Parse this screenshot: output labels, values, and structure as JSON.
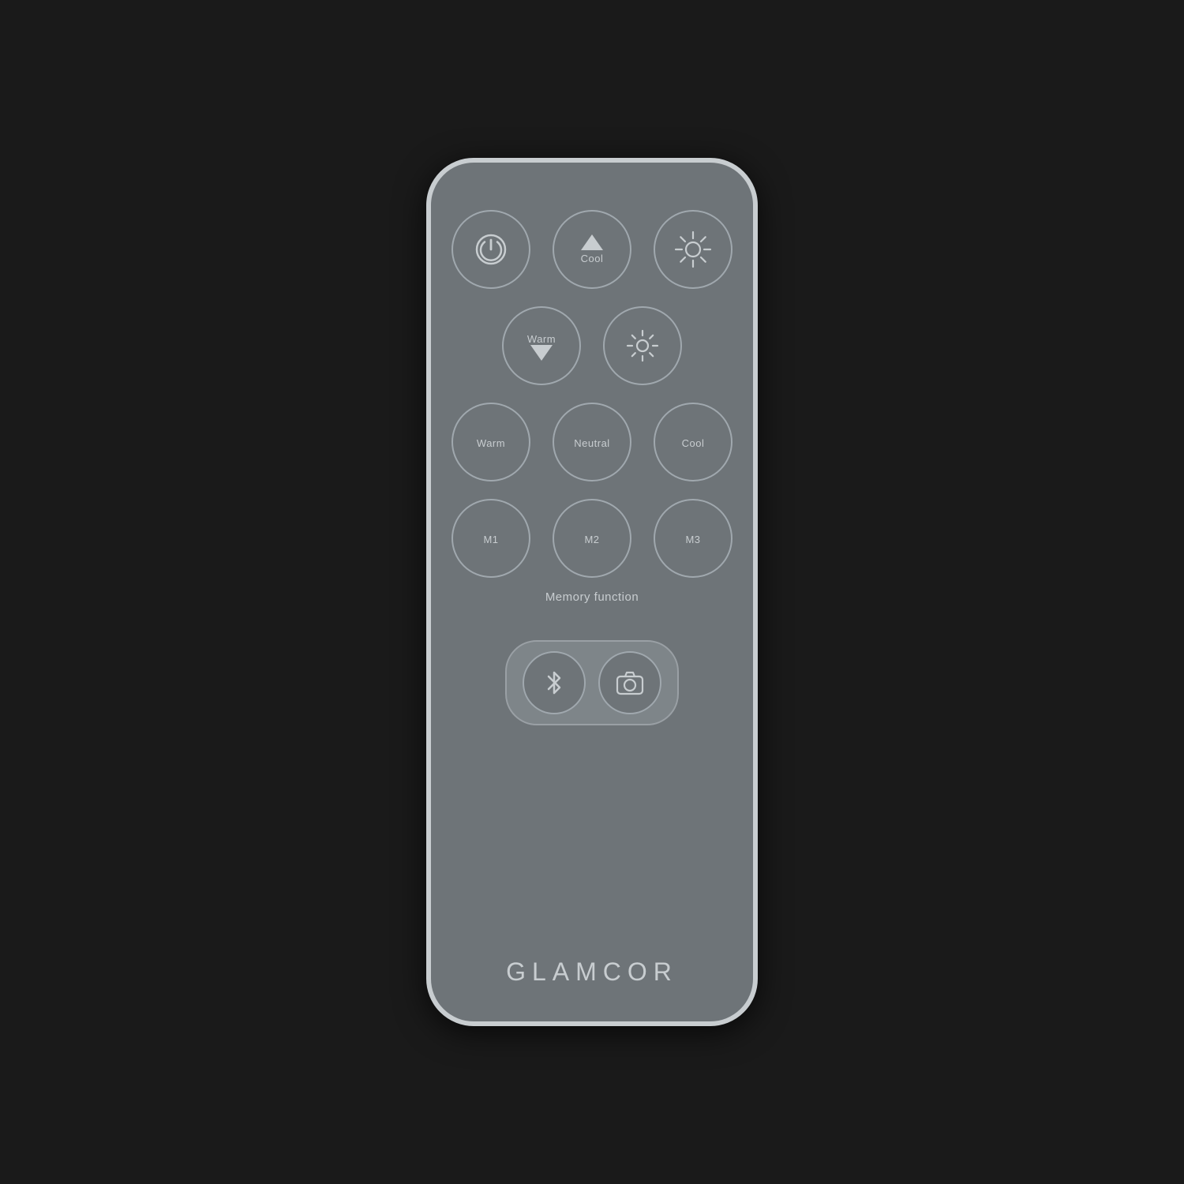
{
  "remote": {
    "brand": "GLAMCOR",
    "row1": {
      "btn1": {
        "label": "",
        "type": "power"
      },
      "btn2": {
        "label": "Cool",
        "type": "cool-up"
      },
      "btn3": {
        "label": "",
        "type": "brightness-high"
      }
    },
    "row2": {
      "btn1": {
        "label": "Warm",
        "type": "warm-down"
      },
      "btn2": {
        "label": "",
        "type": "brightness-low"
      }
    },
    "row3": {
      "btn1": {
        "label": "Warm",
        "type": "warm"
      },
      "btn2": {
        "label": "Neutral",
        "type": "neutral"
      },
      "btn3": {
        "label": "Cool",
        "type": "cool"
      }
    },
    "row4": {
      "btn1": {
        "label": "M1",
        "type": "memory1"
      },
      "btn2": {
        "label": "M2",
        "type": "memory2"
      },
      "btn3": {
        "label": "M3",
        "type": "memory3"
      }
    },
    "memory_label": "Memory function",
    "bluetooth_btn": {
      "label": "bluetooth"
    },
    "camera_btn": {
      "label": "camera"
    }
  }
}
